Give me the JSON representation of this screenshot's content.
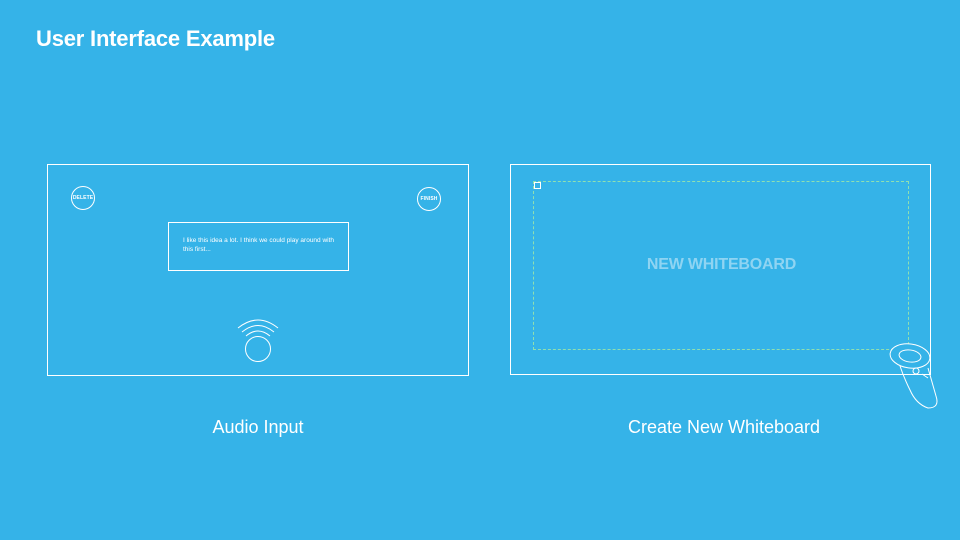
{
  "slide": {
    "title": "User Interface Example"
  },
  "audio_panel": {
    "delete_label": "DELETE",
    "finish_label": "FINISH",
    "transcript_text": "I like this idea a lot. I think we could play around with this first...",
    "mic_icon": "wireless-mic-icon",
    "caption": "Audio Input"
  },
  "whiteboard_panel": {
    "label": "NEW WHITEBOARD",
    "controller_icon": "vr-controller-icon",
    "caption": "Create New Whiteboard"
  },
  "colors": {
    "background": "#35b3e8",
    "foreground": "#ffffff",
    "dashed_outline": "#8fe0b0",
    "placeholder_text": "#8fd4f2"
  }
}
